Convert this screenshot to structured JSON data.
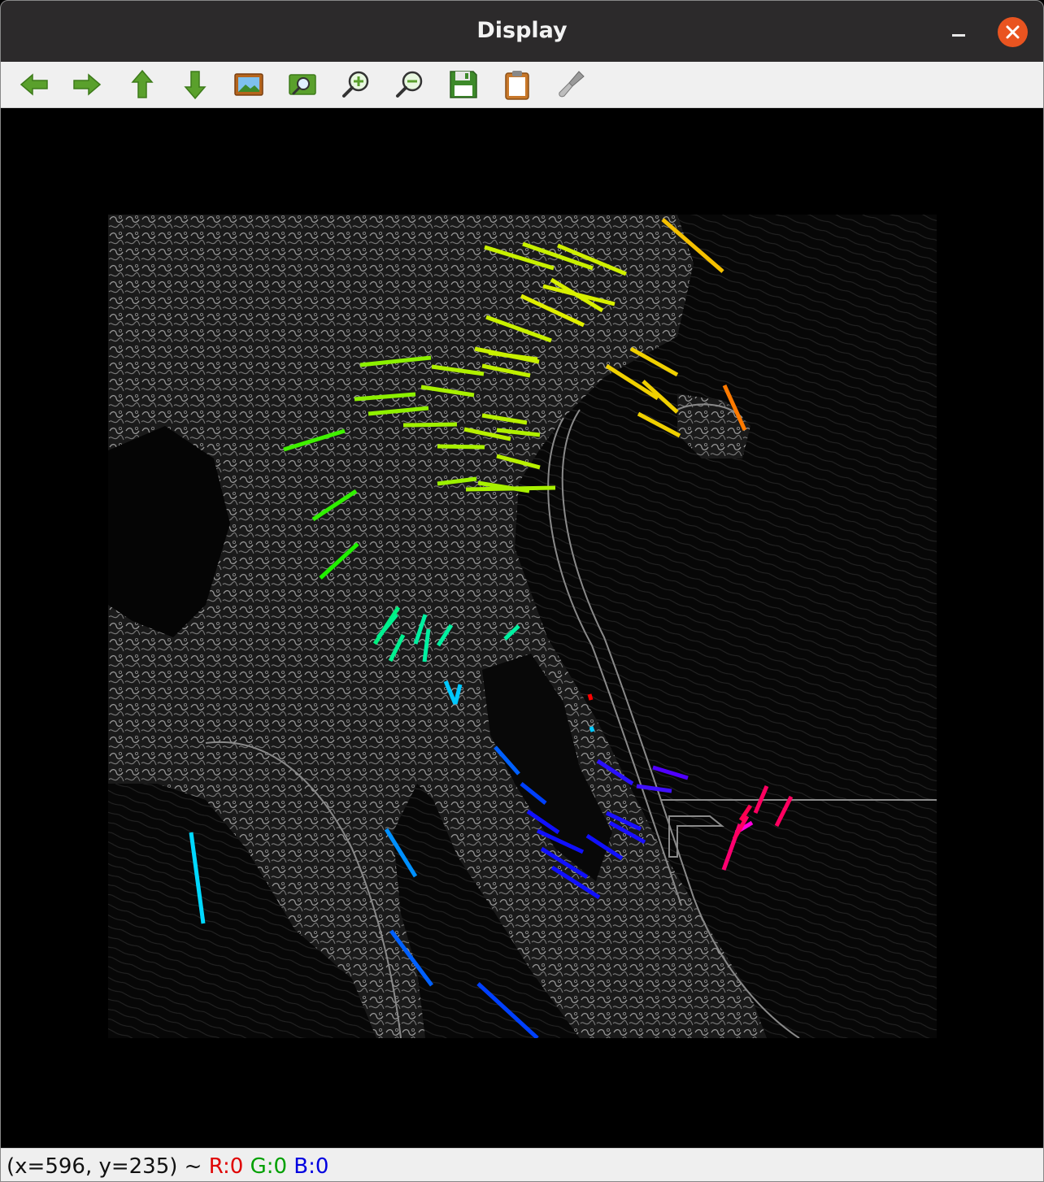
{
  "window": {
    "title": "Display",
    "close_label": "✕"
  },
  "toolbar": {
    "buttons": [
      {
        "name": "pan-left-button",
        "icon": "arrow-left-icon"
      },
      {
        "name": "pan-right-button",
        "icon": "arrow-right-icon"
      },
      {
        "name": "pan-up-button",
        "icon": "arrow-up-icon"
      },
      {
        "name": "pan-down-button",
        "icon": "arrow-down-icon"
      },
      {
        "name": "zoom-fit-button",
        "icon": "image-icon"
      },
      {
        "name": "zoom-region-button",
        "icon": "zoom-region-icon"
      },
      {
        "name": "zoom-in-button",
        "icon": "zoom-in-icon"
      },
      {
        "name": "zoom-out-button",
        "icon": "zoom-out-icon"
      },
      {
        "name": "save-button",
        "icon": "floppy-disk-icon"
      },
      {
        "name": "copy-button",
        "icon": "clipboard-icon"
      },
      {
        "name": "properties-button",
        "icon": "brush-icon"
      }
    ]
  },
  "status": {
    "coords": "(x=596, y=235) ~ ",
    "r": "R:0",
    "g": "G:0",
    "b": "B:0"
  },
  "colors": {
    "titlebar": "#2c2a2b",
    "close": "#e95420",
    "toolbar": "#f0f0f0",
    "icon_green": "#5aa02c",
    "segments": {
      "yellow_green": "#b8f000",
      "yellow": "#f5d000",
      "orange": "#ff7a00",
      "green": "#22f000",
      "spring_green": "#00f080",
      "cyan": "#00d8ff",
      "blue": "#0060ff",
      "deep_blue": "#1010ff",
      "violet": "#6000ff",
      "magenta": "#ff00e0",
      "pink": "#ff0070",
      "red": "#ff0000"
    }
  }
}
